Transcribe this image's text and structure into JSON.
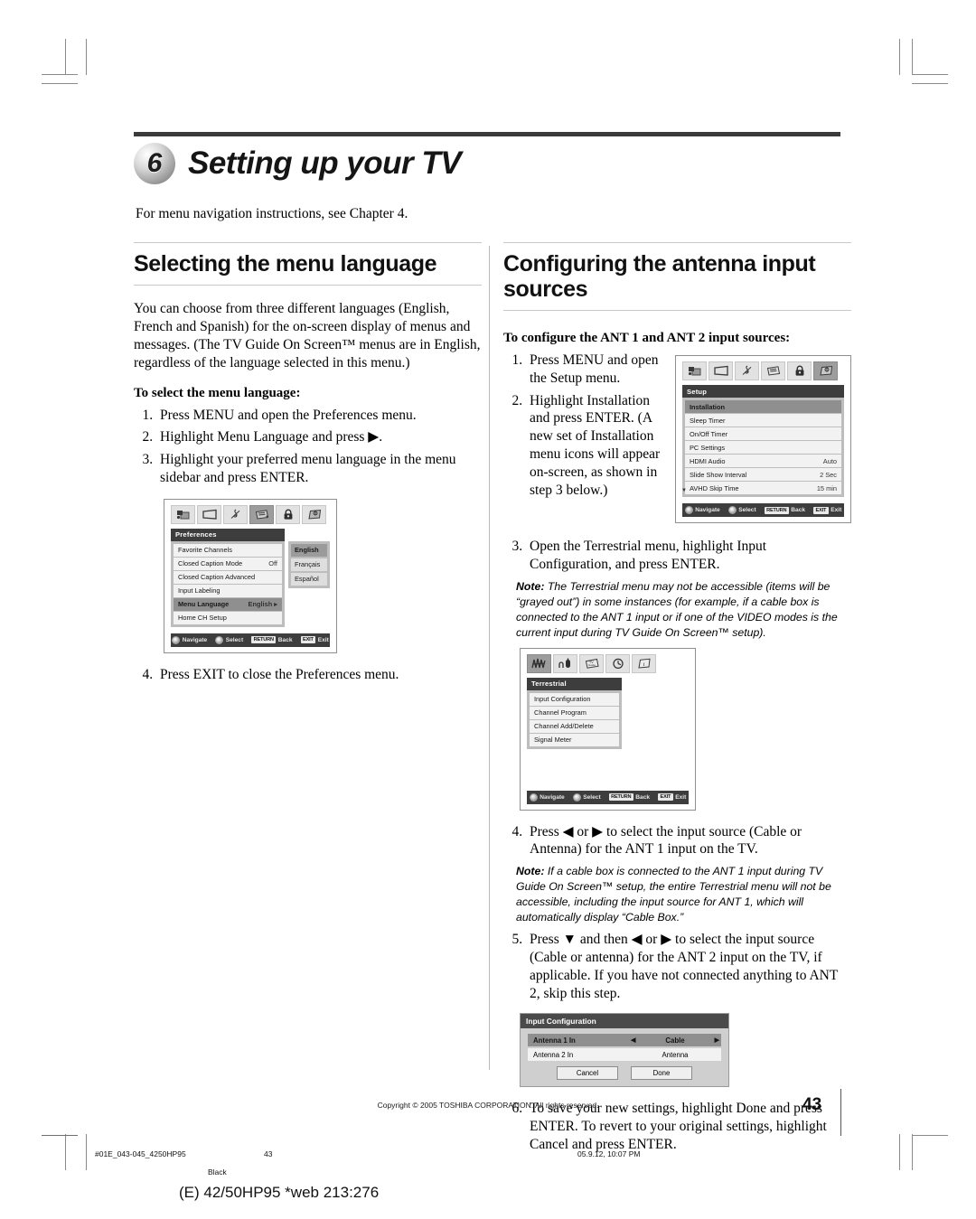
{
  "chapter": {
    "number": "6",
    "title": "Setting up your TV",
    "intro": "For menu navigation instructions, see Chapter 4."
  },
  "left_column": {
    "section_title": "Selecting the menu language",
    "paragraph": "You can choose from three different languages (English, French and Spanish) for the on-screen display of menus and messages. (The TV Guide On Screen™ menus are in English, regardless of the language selected in this menu.)",
    "lead": "To select the menu language:",
    "steps": [
      "Press MENU and open the Preferences menu.",
      "Highlight Menu Language and press ▶.",
      "Highlight your preferred menu language in the menu sidebar and press ENTER."
    ],
    "step_after_image": "Press EXIT to close the Preferences menu."
  },
  "preferences_osd": {
    "icons": [
      "picture-icon",
      "screen-icon",
      "audio-icon",
      "preferences-icon",
      "lock-icon",
      "setup-icon"
    ],
    "selected_icon_index": 3,
    "title": "Preferences",
    "rows": [
      {
        "label": "Favorite Channels",
        "value": "",
        "highlight": false
      },
      {
        "label": "Closed Caption Mode",
        "value": "Off",
        "highlight": false
      },
      {
        "label": "Closed Caption Advanced",
        "value": "",
        "highlight": false
      },
      {
        "label": "Input Labeling",
        "value": "",
        "highlight": false
      },
      {
        "label": "Menu Language",
        "value": "English ▸",
        "highlight": true
      },
      {
        "label": "Home CH Setup",
        "value": "",
        "highlight": false
      }
    ],
    "sidebar_options": [
      {
        "label": "English",
        "selected": true
      },
      {
        "label": "Français",
        "selected": false
      },
      {
        "label": "Español",
        "selected": false
      }
    ],
    "footer": {
      "navigate": "Navigate",
      "select": "Select",
      "back_key": "RETURN",
      "back": "Back",
      "exit_key": "EXIT",
      "exit": "Exit"
    }
  },
  "right_column": {
    "section_title": "Configuring the antenna input sources",
    "lead": "To configure the ANT 1 and ANT 2 input sources:",
    "steps_1_2": [
      "Press MENU and open the Setup menu.",
      "Highlight Installation and press ENTER. (A new set of Installation menu icons will appear on-screen, as shown in step 3 below.)"
    ],
    "step3": "Open the Terrestrial menu, highlight Input Configuration, and press ENTER.",
    "note3_label": "Note:",
    "note3": "The Terrestrial menu may not be accessible (items will be “grayed out”) in some instances (for example, if a cable box is connected to the ANT 1 input or if one of the VIDEO modes is the current input during TV Guide On Screen™ setup).",
    "step4": "Press ◀ or ▶ to select the input source (Cable or Antenna) for the ANT 1 input on the TV.",
    "note4_label": "Note:",
    "note4": "If a cable box is connected to the ANT 1 input during TV Guide On Screen™ setup, the entire Terrestrial menu will not be accessible, including the input source for ANT 1, which will automatically display “Cable Box.”",
    "step5": "Press ▼ and then ◀ or ▶ to select the input source (Cable or antenna) for the ANT 2 input on the TV, if applicable. If you have not connected anything to ANT 2, skip this step.",
    "step6": "To save your new settings, highlight Done and press ENTER. To revert to your original settings, highlight Cancel and press ENTER."
  },
  "setup_osd": {
    "icons": [
      "picture-icon",
      "screen-icon",
      "audio-icon",
      "preferences-icon",
      "lock-icon",
      "setup-icon"
    ],
    "selected_icon_index": 5,
    "title": "Setup",
    "rows": [
      {
        "label": "Installation",
        "value": "",
        "highlight": true
      },
      {
        "label": "Sleep Timer",
        "value": "",
        "highlight": false
      },
      {
        "label": "On/Off Timer",
        "value": "",
        "highlight": false
      },
      {
        "label": "PC Settings",
        "value": "",
        "highlight": false
      },
      {
        "label": "HDMI Audio",
        "value": "Auto",
        "highlight": false
      },
      {
        "label": "Slide Show Interval",
        "value": "2 Sec",
        "highlight": false
      },
      {
        "label": "AVHD Skip Time",
        "value": "15 min",
        "highlight": false
      }
    ],
    "scroll_marker": "▼",
    "footer": {
      "navigate": "Navigate",
      "select": "Select",
      "back_key": "RETURN",
      "back": "Back",
      "exit_key": "EXIT",
      "exit": "Exit"
    }
  },
  "terrestrial_osd": {
    "icons": [
      "antenna-icon",
      "connector-icon",
      "tvguide-icon",
      "clock-icon",
      "info-icon"
    ],
    "selected_icon_index": 0,
    "title": "Terrestrial",
    "rows": [
      {
        "label": "Input Configuration"
      },
      {
        "label": "Channel Program"
      },
      {
        "label": "Channel Add/Delete"
      },
      {
        "label": "Signal Meter"
      }
    ],
    "footer": {
      "navigate": "Navigate",
      "select": "Select",
      "back_key": "RETURN",
      "back": "Back",
      "exit_key": "EXIT",
      "exit": "Exit"
    }
  },
  "input_configuration_dialog": {
    "title": "Input Configuration",
    "rows": [
      {
        "label": "Antenna 1 In",
        "value": "Cable",
        "selected": true,
        "left_arrow": "◀",
        "right_arrow": "▶"
      },
      {
        "label": "Antenna 2 In",
        "value": "Antenna",
        "selected": false
      }
    ],
    "cancel_label": "Cancel",
    "done_label": "Done"
  },
  "page_footer": {
    "copyright": "Copyright © 2005 TOSHIBA CORPORATION. All rights reserved.",
    "page_number": "43",
    "file_id": "#01E_043-045_4250HP95",
    "sheet_page": "43",
    "timestamp": "05.9.12, 10:07 PM",
    "color_plate": "Black",
    "web_line": "(E) 42/50HP95 *web 213:276"
  }
}
